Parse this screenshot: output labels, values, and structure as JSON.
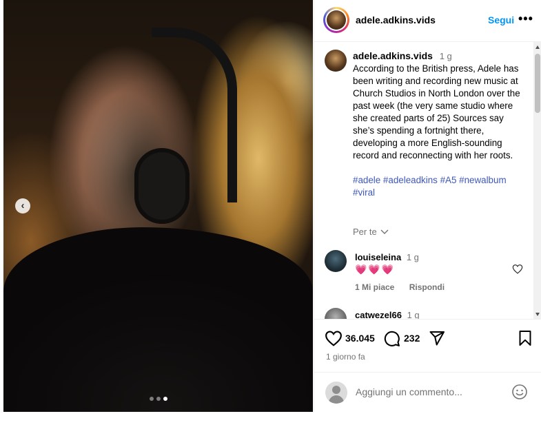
{
  "post": {
    "username": "adele.adkins.vids",
    "follow_label": "Segui",
    "more_label": "•••",
    "caption": {
      "username": "adele.adkins.vids",
      "time": "1 g",
      "text": "According to the British press, Adele has been writing and recording new music at Church Studios in North London over the past week (the very same studio where she created parts of 25) Sources say she’s spending a fortnight there, developing a more English-sounding record and reconnecting with her roots.",
      "hashtags": "#adele #adeleadkins #A5 #newalbum #viral"
    },
    "translation_label": "Per te",
    "comments": [
      {
        "username": "louiseleina",
        "time": "1 g",
        "text": "💗💗💗",
        "likes_label": "1 Mi piace",
        "reply_label": "Rispondi"
      },
      {
        "username": "catwezel66",
        "time": "1 g"
      }
    ],
    "likes": "36.045",
    "comment_count": "232",
    "posted": "1 giorno fa",
    "comment_placeholder": "Aggiungi un commento...",
    "carousel": {
      "slides": 3,
      "active": 3
    }
  },
  "icons": {
    "prev": "chevron-left-icon",
    "like": "heart-icon",
    "comment": "comment-icon",
    "share": "paper-plane-icon",
    "save": "bookmark-icon",
    "emoji": "emoji-icon"
  },
  "colors": {
    "accent": "#0095f6",
    "hashtag": "#3f58b8",
    "heart_red": "#ed2c5c",
    "muted": "#737373"
  }
}
